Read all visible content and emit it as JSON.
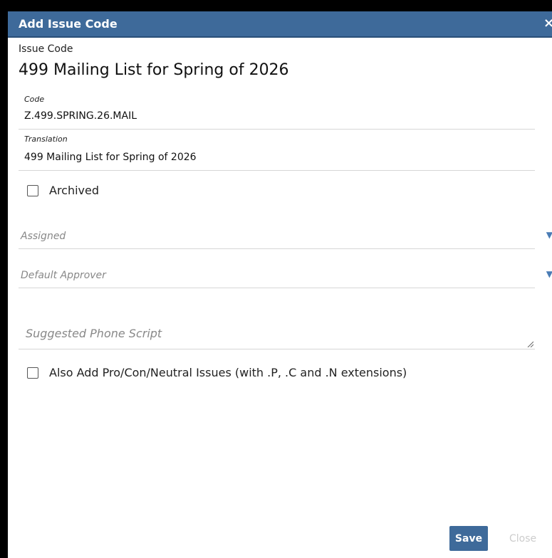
{
  "dialog": {
    "title": "Add Issue Code",
    "close_icon": "close-icon"
  },
  "header": {
    "label": "Issue Code",
    "value": "499 Mailing List for Spring of 2026"
  },
  "fields": {
    "code": {
      "label": "Code",
      "value": "Z.499.SPRING.26.MAIL"
    },
    "translation": {
      "label": "Translation",
      "value": "499 Mailing List for Spring of 2026"
    }
  },
  "archived": {
    "label": "Archived",
    "checked": false
  },
  "assigned": {
    "placeholder": "Assigned",
    "icon": "dropdown-arrow-icon"
  },
  "default_approver": {
    "placeholder": "Default Approver",
    "icon": "dropdown-arrow-icon"
  },
  "phone_script": {
    "placeholder": "Suggested Phone Script"
  },
  "also_add": {
    "label": "Also Add Pro/Con/Neutral Issues (with .P, .C and .N extensions)",
    "checked": false
  },
  "footer": {
    "save_label": "Save",
    "close_label": "Close"
  },
  "colors": {
    "accent": "#3e6a9a",
    "arrow": "#4a7cb5"
  }
}
